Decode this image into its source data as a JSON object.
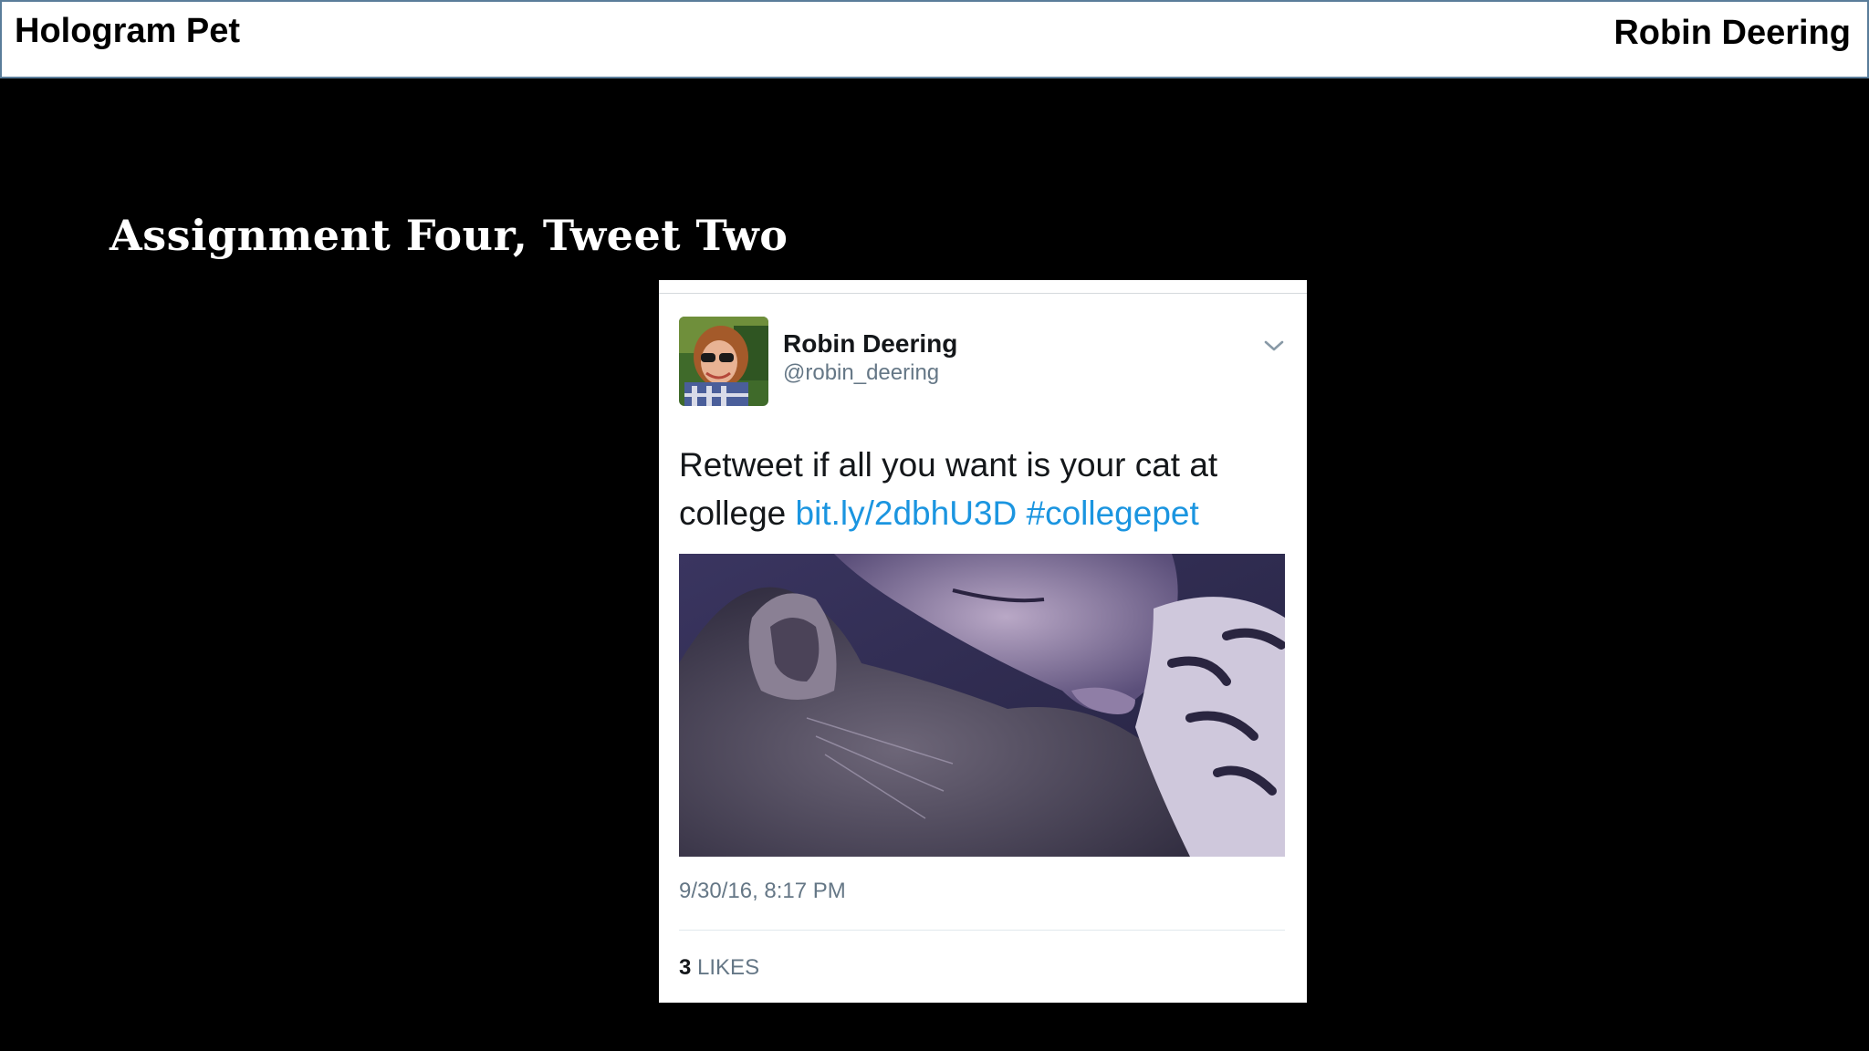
{
  "header": {
    "left_title": "Hologram Pet",
    "right_title": "Robin Deering"
  },
  "slide": {
    "title": "Assignment Four, Tweet Two"
  },
  "tweet": {
    "display_name": "Robin Deering",
    "handle": "@robin_deering",
    "text_plain": "Retweet if all you want is your cat at college ",
    "link": "bit.ly/2dbhU3D",
    "hashtag": "#collegepet",
    "timestamp": "9/30/16, 8:17 PM",
    "likes_count": "3",
    "likes_label": "LIKES",
    "icons": {
      "menu": "chevron-down-icon",
      "avatar": "profile-photo",
      "media": "photo-cat-and-person"
    },
    "colors": {
      "link": "#1b95e0",
      "text": "#14171a",
      "muted": "#657786"
    }
  }
}
